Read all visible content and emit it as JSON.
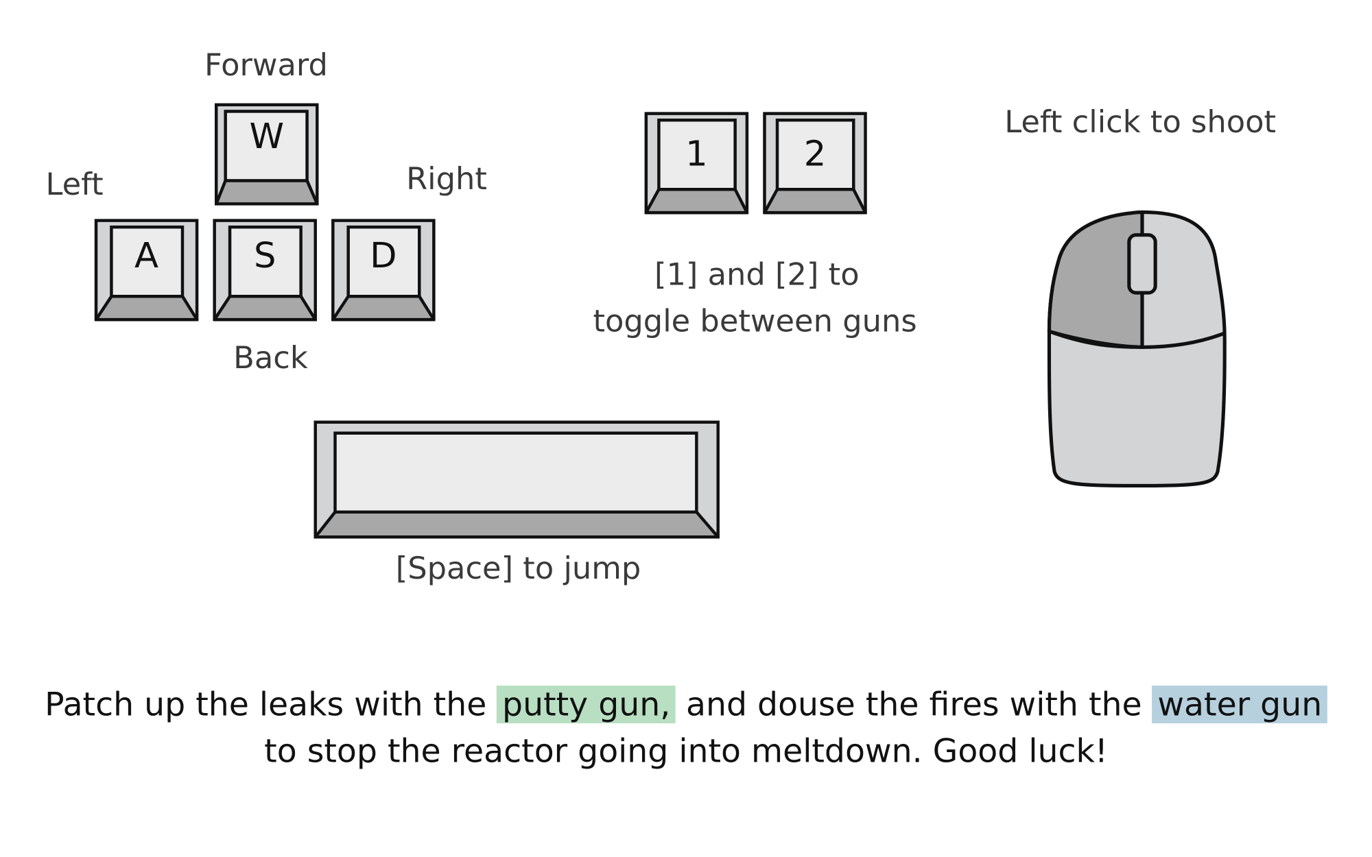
{
  "controls": {
    "movement": {
      "keys": [
        {
          "id": "w",
          "letter": "W",
          "label": "Forward"
        },
        {
          "id": "a",
          "letter": "A",
          "label": "Left"
        },
        {
          "id": "s",
          "letter": "S",
          "label": "Back"
        },
        {
          "id": "d",
          "letter": "D",
          "label": "Right"
        }
      ]
    },
    "guns": {
      "keys": [
        "1",
        "2"
      ],
      "caption_line1": "[1] and [2] to",
      "caption_line2": "toggle between guns"
    },
    "jump": {
      "caption": "[Space] to jump"
    },
    "shoot": {
      "caption": "Left click to shoot"
    }
  },
  "instructions": {
    "part1": "Patch up the leaks with the",
    "highlight1": "putty gun,",
    "part2": "and douse the fires with the",
    "highlight2": "water gun",
    "line2": "to stop the reactor going into meltdown. Good luck!"
  },
  "colors": {
    "keycap_face": "#ececec",
    "keycap_side": "#d2d4d6",
    "keycap_bottom": "#a8a8a8",
    "outline": "#111111",
    "mouse_left_button": "#a8a8a8",
    "mouse_body": "#d2d4d6",
    "highlight_putty": "#b8dfc2",
    "highlight_water": "#b6d0de"
  }
}
